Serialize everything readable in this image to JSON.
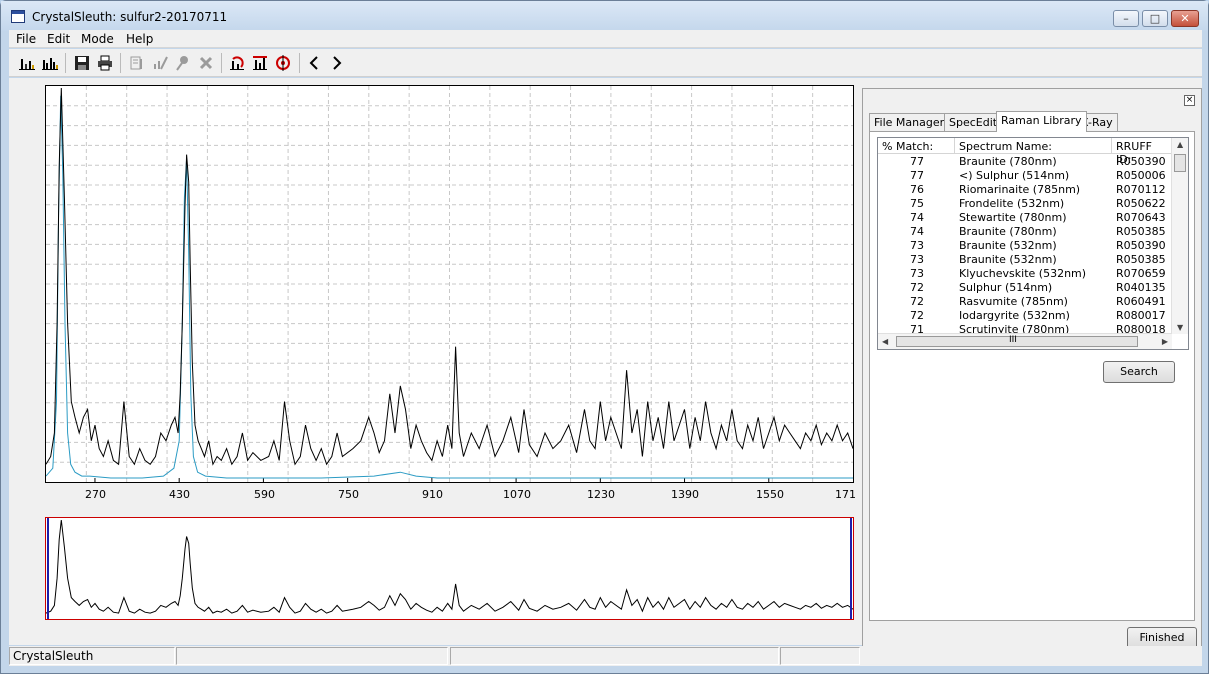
{
  "window": {
    "title": "CrystalSleuth: sulfur2-20170711"
  },
  "menu": {
    "items": [
      "File",
      "Edit",
      "Mode",
      "Help"
    ]
  },
  "toolbar": {
    "buttons": [
      {
        "name": "spectrum-view-icon",
        "enabled": true
      },
      {
        "name": "multi-spectrum-icon",
        "enabled": true
      },
      {
        "name": "save-icon",
        "enabled": true
      },
      {
        "name": "print-icon",
        "enabled": true
      },
      {
        "name": "edit-list-icon",
        "enabled": false
      },
      {
        "name": "edit-chart-icon",
        "enabled": false
      },
      {
        "name": "pin-icon",
        "enabled": false
      },
      {
        "name": "delete-icon",
        "enabled": false
      },
      {
        "name": "refresh-icon",
        "enabled": true
      },
      {
        "name": "peak-fit-icon",
        "enabled": true
      },
      {
        "name": "target-icon",
        "enabled": true
      },
      {
        "name": "previous-icon",
        "enabled": true
      },
      {
        "name": "next-icon",
        "enabled": true
      }
    ]
  },
  "chart_data": {
    "type": "line",
    "x_ticks": [
      "270",
      "430",
      "590",
      "750",
      "910",
      "1070",
      "1230",
      "1390",
      "1550",
      "171"
    ],
    "xlim": [
      177,
      1710
    ],
    "grid": true,
    "colors": {
      "sample": "#000000",
      "reference": "#2b9bc4",
      "overview_border": "#cc0000",
      "range_marker": "#1d1daa"
    },
    "series": [
      {
        "color": "#000000",
        "x": [
          177,
          186,
          193,
          198,
          202,
          206,
          212,
          218,
          225,
          232,
          240,
          248,
          256,
          263,
          270,
          278,
          286,
          295,
          305,
          315,
          325,
          335,
          345,
          355,
          365,
          375,
          385,
          395,
          405,
          415,
          422,
          428,
          432,
          436,
          441,
          444,
          448,
          451,
          455,
          460,
          466,
          472,
          478,
          486,
          494,
          502,
          510,
          520,
          530,
          540,
          550,
          560,
          570,
          585,
          600,
          610,
          620,
          630,
          640,
          650,
          660,
          670,
          680,
          690,
          700,
          710,
          720,
          730,
          740,
          760,
          775,
          790,
          800,
          810,
          820,
          830,
          840,
          850,
          860,
          870,
          880,
          890,
          900,
          910,
          920,
          930,
          940,
          948,
          955,
          962,
          970,
          985,
          1000,
          1015,
          1030,
          1045,
          1060,
          1075,
          1085,
          1095,
          1110,
          1125,
          1140,
          1155,
          1170,
          1185,
          1200,
          1210,
          1220,
          1230,
          1240,
          1250,
          1260,
          1270,
          1280,
          1290,
          1300,
          1310,
          1320,
          1330,
          1340,
          1350,
          1360,
          1370,
          1380,
          1390,
          1400,
          1410,
          1420,
          1430,
          1440,
          1450,
          1460,
          1470,
          1480,
          1490,
          1500,
          1510,
          1520,
          1530,
          1540,
          1550,
          1560,
          1570,
          1580,
          1590,
          1600,
          1610,
          1620,
          1630,
          1640,
          1650,
          1660,
          1670,
          1680,
          1690,
          1700,
          1710
        ],
        "y": [
          0.04,
          0.06,
          0.12,
          0.4,
          0.8,
          1.0,
          0.72,
          0.4,
          0.2,
          0.16,
          0.12,
          0.16,
          0.18,
          0.1,
          0.14,
          0.08,
          0.06,
          0.1,
          0.05,
          0.04,
          0.2,
          0.06,
          0.04,
          0.08,
          0.05,
          0.04,
          0.06,
          0.12,
          0.1,
          0.14,
          0.16,
          0.12,
          0.22,
          0.4,
          0.7,
          0.83,
          0.76,
          0.55,
          0.3,
          0.14,
          0.1,
          0.08,
          0.06,
          0.1,
          0.04,
          0.06,
          0.05,
          0.08,
          0.04,
          0.06,
          0.12,
          0.05,
          0.07,
          0.05,
          0.06,
          0.1,
          0.05,
          0.2,
          0.1,
          0.04,
          0.06,
          0.14,
          0.08,
          0.05,
          0.08,
          0.04,
          0.06,
          0.12,
          0.06,
          0.08,
          0.1,
          0.16,
          0.12,
          0.07,
          0.1,
          0.22,
          0.12,
          0.24,
          0.18,
          0.08,
          0.14,
          0.1,
          0.07,
          0.05,
          0.1,
          0.06,
          0.14,
          0.08,
          0.34,
          0.12,
          0.06,
          0.12,
          0.08,
          0.14,
          0.06,
          0.1,
          0.16,
          0.07,
          0.18,
          0.09,
          0.06,
          0.12,
          0.08,
          0.1,
          0.14,
          0.07,
          0.18,
          0.1,
          0.08,
          0.2,
          0.1,
          0.16,
          0.12,
          0.08,
          0.28,
          0.12,
          0.18,
          0.06,
          0.2,
          0.1,
          0.16,
          0.08,
          0.2,
          0.1,
          0.14,
          0.18,
          0.08,
          0.16,
          0.1,
          0.2,
          0.12,
          0.08,
          0.14,
          0.1,
          0.18,
          0.1,
          0.08,
          0.14,
          0.1,
          0.16,
          0.08,
          0.12,
          0.16,
          0.1,
          0.14,
          0.12,
          0.1,
          0.08,
          0.12,
          0.1,
          0.14,
          0.09,
          0.12,
          0.1,
          0.14,
          0.1,
          0.12,
          0.08
        ]
      },
      {
        "color": "#2b9bc4",
        "x": [
          177,
          190,
          197,
          201,
          205,
          209,
          213,
          218,
          224,
          232,
          245,
          260,
          300,
          360,
          400,
          420,
          430,
          436,
          440,
          444,
          448,
          452,
          457,
          465,
          480,
          520,
          600,
          700,
          800,
          850,
          880,
          920,
          1000,
          1200,
          1400,
          1600,
          1710
        ],
        "y": [
          0.01,
          0.03,
          0.2,
          0.68,
          0.98,
          0.78,
          0.4,
          0.12,
          0.04,
          0.02,
          0.01,
          0.01,
          0.005,
          0.005,
          0.01,
          0.03,
          0.1,
          0.4,
          0.72,
          0.82,
          0.58,
          0.22,
          0.06,
          0.02,
          0.01,
          0.005,
          0.005,
          0.005,
          0.01,
          0.02,
          0.01,
          0.005,
          0.005,
          0.005,
          0.005,
          0.005,
          0.005
        ]
      }
    ]
  },
  "panel": {
    "tabs": [
      "File Manager",
      "SpecEdit",
      "Raman Library",
      "X-Ray"
    ],
    "active_tab": 2,
    "columns": [
      "% Match:",
      "Spectrum Name:",
      "RRUFF ID:"
    ],
    "rows": [
      [
        "77",
        "Braunite  (780nm)",
        "R050390"
      ],
      [
        "77",
        "<) Sulphur  (514nm)",
        "R050006"
      ],
      [
        "76",
        "Riomarinaite  (785nm)",
        "R070112"
      ],
      [
        "75",
        "Frondelite  (532nm)",
        "R050622"
      ],
      [
        "74",
        "Stewartite  (780nm)",
        "R070643"
      ],
      [
        "74",
        "Braunite  (780nm)",
        "R050385"
      ],
      [
        "73",
        "Braunite  (532nm)",
        "R050390"
      ],
      [
        "73",
        "Braunite  (532nm)",
        "R050385"
      ],
      [
        "73",
        "Klyuchevskite  (532nm)",
        "R070659"
      ],
      [
        "72",
        "Sulphur  (514nm)",
        "R040135"
      ],
      [
        "72",
        "Rasvumite  (785nm)",
        "R060491"
      ],
      [
        "72",
        "Iodargyrite  (532nm)",
        "R080017"
      ],
      [
        "71",
        "Scrutinyite  (780nm)",
        "R080018"
      ]
    ],
    "search_label": "Search",
    "finished_label": "Finished",
    "scroll_grip": "III"
  },
  "status": {
    "text": "CrystalSleuth"
  }
}
